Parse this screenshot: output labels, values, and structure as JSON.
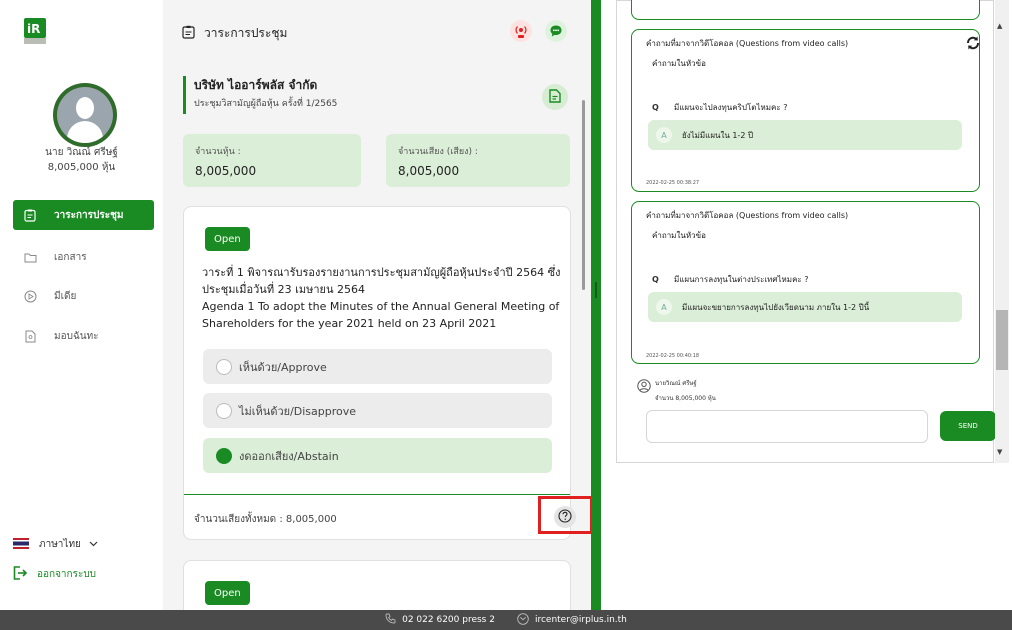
{
  "sidebar": {
    "logo_text": "iR PLUS",
    "user_name": "นาย วิณณ์ ศรีษฐ์",
    "user_shares": "8,005,000 หุ้น",
    "nav": [
      {
        "label": "วาระการประชุม",
        "icon": "agenda-icon"
      },
      {
        "label": "เอกสาร",
        "icon": "folder-icon"
      },
      {
        "label": "มีเดีย",
        "icon": "play-icon"
      },
      {
        "label": "มอบฉันทะ",
        "icon": "proxy-icon"
      }
    ],
    "language": "ภาษาไทย",
    "logout": "ออกจากระบบ"
  },
  "middle": {
    "title": "วาระการประชุม",
    "company": "บริษัท ไออาร์พลัส จำกัด",
    "meeting": "ประชุมวิสามัญผู้ถือหุ้น ครั้งที่ 1/2565",
    "stats": [
      {
        "label": "จำนวนหุ้น :",
        "value": "8,005,000"
      },
      {
        "label": "จำนวนเสียง (เสียง) :",
        "value": "8,005,000"
      }
    ],
    "agenda": {
      "status": "Open",
      "title_th": "วาระที่ 1 พิจารณารับรองรายงานการประชุมสามัญผู้ถือหุ้นประจำปี 2564 ซึ่งประชุมเมื่อวันที่ 23 เมษายน 2564",
      "title_en": "Agenda 1 To adopt the Minutes of the Annual General Meeting of Shareholders for the year 2021 held on 23 April 2021",
      "options": [
        {
          "label": "เห็นด้วย/Approve",
          "selected": false
        },
        {
          "label": "ไม่เห็นด้วย/Disapprove",
          "selected": false
        },
        {
          "label": "งดออกเสียง/Abstain",
          "selected": true
        }
      ],
      "total_votes": "จำนวนเสียงทั้งหมด : 8,005,000"
    },
    "agenda2_status": "Open"
  },
  "qa": {
    "cards": [
      {
        "header": "คำถามที่มาจากวิดีโอคอล (Questions from video calls)",
        "topic": "คำถามในหัวข้อ",
        "q_mark": "Q",
        "question": "มีแผนจะไปลงทุนคริปโตไหมคะ ?",
        "a_mark": "A",
        "answer": "ยังไม่มีแผนใน 1-2 ปี",
        "time": "2022-02-25 00:38:27"
      },
      {
        "header": "คำถามที่มาจากวิดีโอคอล (Questions from video calls)",
        "topic": "คำถามในหัวข้อ",
        "q_mark": "Q",
        "question": "มีแผนการลงทุนในต่างประเทศไหมคะ ?",
        "a_mark": "A",
        "answer": "มีแผนจะขยายการลงทุนไปยังเวียดนาม ภายใน 1-2 ปีนี้",
        "time": "2022-02-25 00:40:18"
      }
    ],
    "asker_name": "นายวิณณ์ ศรีษฐ์",
    "asker_shares": "จำนวน 8,005,000 หุ้น",
    "send": "SEND"
  },
  "footer": {
    "phone": "02 022 6200 press 2",
    "email": "ircenter@irplus.in.th"
  },
  "colors": {
    "brand_green": "#1a8b23",
    "light_green": "#dbeed7",
    "highlight_red": "#e0201f",
    "footer_bg": "#4a4a4a"
  }
}
